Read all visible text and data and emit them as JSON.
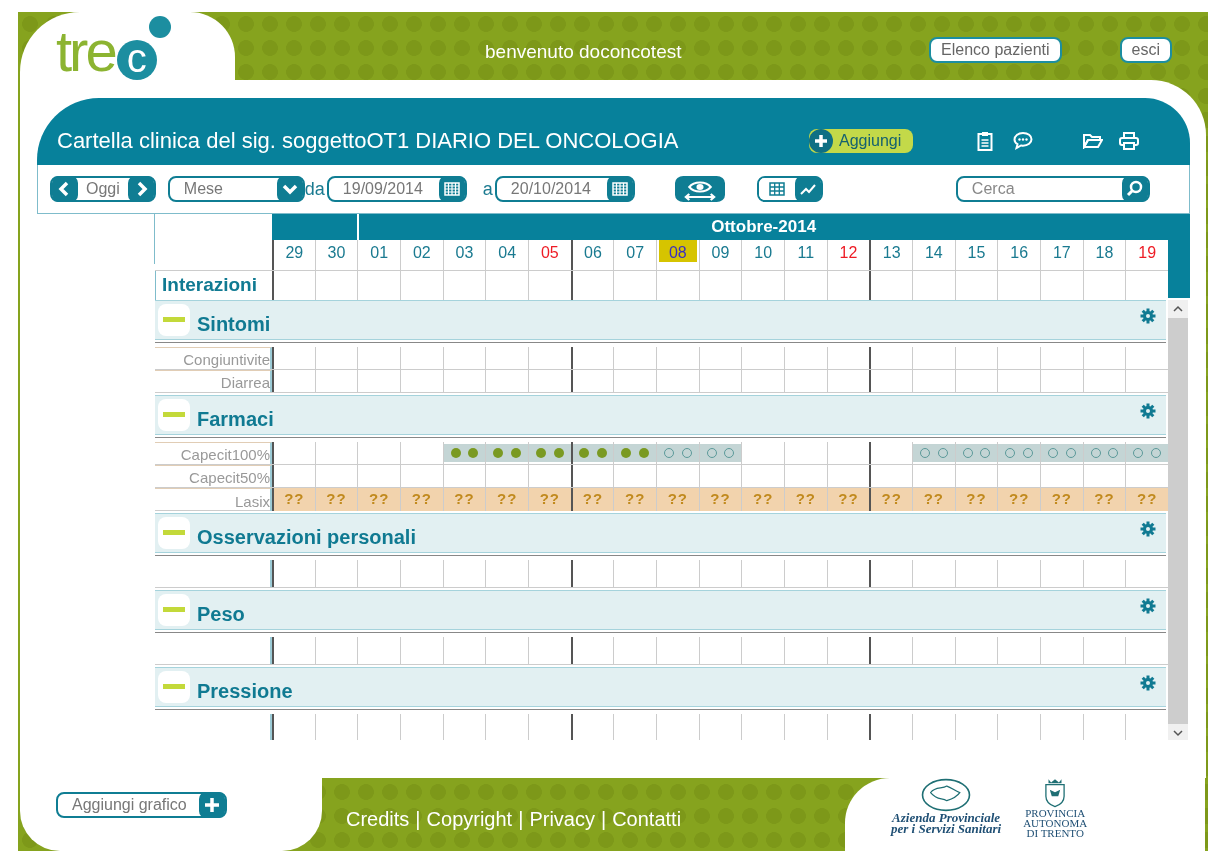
{
  "logo": {
    "main": "tre",
    "accent": "c"
  },
  "welcome": "benvenuto doconcotest",
  "top_buttons": [
    "Elenco pazienti",
    "esci"
  ],
  "header": {
    "title": "Cartella clinica del sig. soggettoOT1 DIARIO DEL ONCOLOGIA",
    "add_button": "Aggiungi"
  },
  "toolbar": {
    "today_button": "Oggi",
    "period_select": "Mese",
    "from_label": "da",
    "from_date": "19/09/2014",
    "to_label": "a",
    "to_date": "20/10/2014",
    "view_grid_selected": false,
    "view_chart_selected": true,
    "search": {
      "placeholder": "Cerca"
    }
  },
  "calendar": {
    "months": [
      {
        "days": [
          {
            "label": "29",
            "holiday": false,
            "today": false,
            "week_start": true
          },
          {
            "label": "30",
            "holiday": false,
            "today": false,
            "week_start": false
          }
        ]
      },
      {
        "label": "Ottobre-2014",
        "days": [
          {
            "label": "01",
            "holiday": false,
            "today": false,
            "week_start": false
          },
          {
            "label": "02",
            "holiday": false,
            "today": false,
            "week_start": false
          },
          {
            "label": "03",
            "holiday": false,
            "today": false,
            "week_start": false
          },
          {
            "label": "04",
            "holiday": false,
            "today": false,
            "week_start": false
          },
          {
            "label": "05",
            "holiday": true,
            "today": false,
            "week_start": false
          },
          {
            "label": "06",
            "holiday": false,
            "today": false,
            "week_start": true
          },
          {
            "label": "07",
            "holiday": false,
            "today": false,
            "week_start": false
          },
          {
            "label": "08",
            "holiday": false,
            "today": true,
            "week_start": false
          },
          {
            "label": "09",
            "holiday": false,
            "today": false,
            "week_start": false
          },
          {
            "label": "10",
            "holiday": false,
            "today": false,
            "week_start": false
          },
          {
            "label": "11",
            "holiday": false,
            "today": false,
            "week_start": false
          },
          {
            "label": "12",
            "holiday": true,
            "today": false,
            "week_start": false
          },
          {
            "label": "13",
            "holiday": false,
            "today": false,
            "week_start": true
          },
          {
            "label": "14",
            "holiday": false,
            "today": false,
            "week_start": false
          },
          {
            "label": "15",
            "holiday": false,
            "today": false,
            "week_start": false
          },
          {
            "label": "16",
            "holiday": false,
            "today": false,
            "week_start": false
          },
          {
            "label": "17",
            "holiday": false,
            "today": false,
            "week_start": false
          },
          {
            "label": "18",
            "holiday": false,
            "today": false,
            "week_start": false
          },
          {
            "label": "19",
            "holiday": true,
            "today": false,
            "week_start": false
          }
        ]
      }
    ],
    "interactions_label": "Interazioni",
    "sections": [
      {
        "title": "Sintomi",
        "expanded": true,
        "rows": [
          {
            "label": "Congiuntivite",
            "kind": "empty"
          },
          {
            "label": "Diarrea",
            "kind": "empty"
          }
        ]
      },
      {
        "title": "Farmaci",
        "expanded": true,
        "rows": [
          {
            "label": "Capecit100%",
            "kind": "doses",
            "cells": [
              {
                "scheduled": false
              },
              {
                "scheduled": false
              },
              {
                "scheduled": false
              },
              {
                "scheduled": false
              },
              {
                "scheduled": true,
                "taken": true
              },
              {
                "scheduled": true,
                "taken": true
              },
              {
                "scheduled": true,
                "taken": true
              },
              {
                "scheduled": true,
                "taken": true
              },
              {
                "scheduled": true,
                "taken": true
              },
              {
                "scheduled": true,
                "taken": false
              },
              {
                "scheduled": true,
                "taken": false
              },
              {
                "scheduled": false
              },
              {
                "scheduled": false
              },
              {
                "scheduled": false
              },
              {
                "scheduled": false
              },
              {
                "scheduled": true,
                "taken": false
              },
              {
                "scheduled": true,
                "taken": false
              },
              {
                "scheduled": true,
                "taken": false
              },
              {
                "scheduled": true,
                "taken": false
              },
              {
                "scheduled": true,
                "taken": false
              },
              {
                "scheduled": true,
                "taken": false
              }
            ]
          },
          {
            "label": "Capecit50%",
            "kind": "empty"
          },
          {
            "label": "Lasix",
            "kind": "text",
            "cells": [
              "??",
              "??",
              "??",
              "??",
              "??",
              "??",
              "??",
              "??",
              "??",
              "??",
              "??",
              "??",
              "??",
              "??",
              "??",
              "??",
              "??",
              "??",
              "??",
              "??",
              "??"
            ]
          }
        ]
      },
      {
        "title": "Osservazioni personali",
        "expanded": true,
        "rows": [
          {
            "kind": "empty"
          }
        ]
      },
      {
        "title": "Peso",
        "expanded": true,
        "rows": [
          {
            "kind": "empty"
          }
        ]
      },
      {
        "title": "Pressione",
        "expanded": true,
        "rows": [
          {
            "kind": "empty"
          }
        ]
      }
    ]
  },
  "footer": {
    "add_chart_button": "Aggiungi grafico",
    "links": [
      "Credits",
      "Copyright",
      "Privacy",
      "Contatti"
    ],
    "separator": "|",
    "asl_logo": [
      "Azienda Provinciale",
      "per i Servizi Sanitari"
    ],
    "province_logo": [
      "PROVINCIA",
      "AUTONOMA",
      "DI TRENTO"
    ]
  }
}
